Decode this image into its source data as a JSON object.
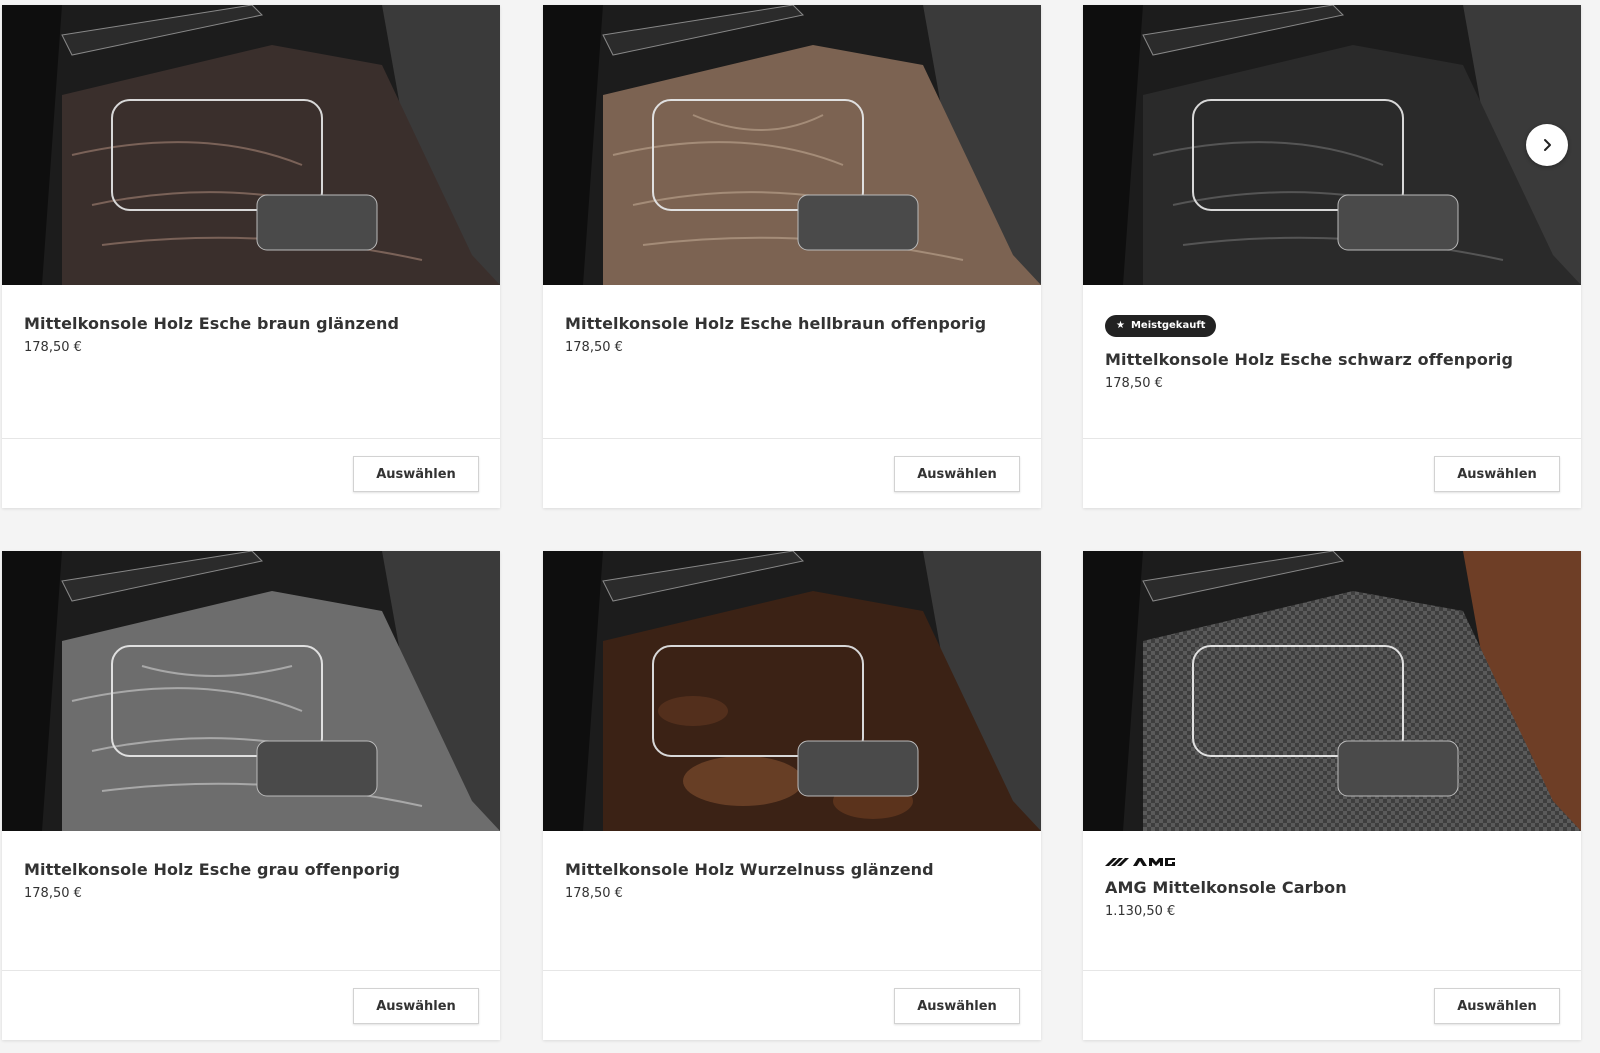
{
  "products": [
    {
      "title": "Mittelkonsole Holz Esche braun glänzend",
      "price": "178,50 €",
      "button": "Auswählen",
      "finish_color": "#3a2f2c",
      "grain_color": "#7a6258"
    },
    {
      "title": "Mittelkonsole Holz Esche hellbraun offenporig",
      "price": "178,50 €",
      "button": "Auswählen",
      "finish_color": "#7c6352",
      "grain_color": "#a48c78"
    },
    {
      "title": "Mittelkonsole Holz Esche schwarz offenporig",
      "price": "178,50 €",
      "button": "Auswählen",
      "badge": "Meistgekauft",
      "finish_color": "#2a2a2a",
      "grain_color": "#555555"
    },
    {
      "title": "Mittelkonsole Holz Esche grau offenporig",
      "price": "178,50 €",
      "button": "Auswählen",
      "finish_color": "#6d6d6d",
      "grain_color": "#a8a8a8"
    },
    {
      "title": "Mittelkonsole Holz Wurzelnuss glänzend",
      "price": "178,50 €",
      "button": "Auswählen",
      "finish_color": "#3b2215",
      "grain_color": "#7a4a2c"
    },
    {
      "title": "AMG Mittelkonsole Carbon",
      "price": "1.130,50 €",
      "button": "Auswählen",
      "brand_logo": "AMG",
      "finish_color": "#4a4a4a",
      "grain_color": "#8a8a8a",
      "seat_color": "#6e3e26"
    }
  ],
  "carousel": {
    "next_icon": "chevron-right-icon"
  },
  "icons": {
    "badge_icon": "star-icon"
  }
}
